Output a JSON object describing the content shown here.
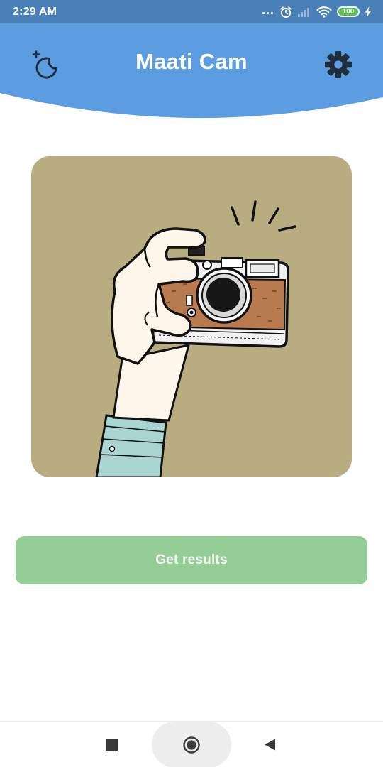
{
  "status_bar": {
    "time": "2:29 AM",
    "dots": "...",
    "battery_level": "100"
  },
  "header": {
    "title": "Maati Cam",
    "bg_color": "#5b9de0",
    "icons": {
      "left": "theme-moon-icon",
      "right": "gear-icon"
    }
  },
  "illustration": {
    "subject": "camera-illustration",
    "bg_color": "#b8ad80"
  },
  "actions": {
    "get_results_label": "Get results",
    "button_color": "#94ce96"
  },
  "nav_bar": {
    "icons": [
      "square-recents-icon",
      "circle-home-icon",
      "triangle-back-icon"
    ]
  }
}
